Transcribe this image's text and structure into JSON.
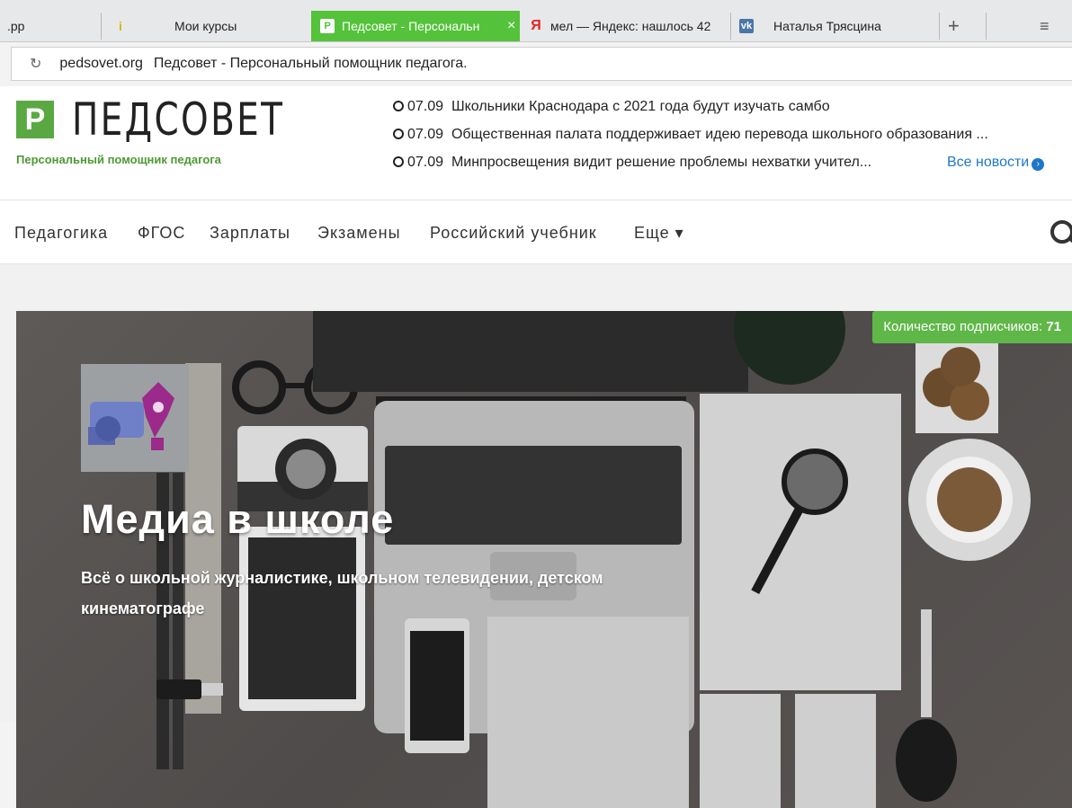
{
  "tabs": [
    {
      "label": ".pp"
    },
    {
      "label": "Мои курсы"
    },
    {
      "label": "Педсовет - Персональн",
      "icon": "pedsovet-icon",
      "active": true
    },
    {
      "label": "мел — Яндекс: нашлось 42",
      "icon": "yandex-icon"
    },
    {
      "label": "Наталья Трясцина",
      "icon": "vk-icon"
    }
  ],
  "tab_close": "×",
  "new_tab": "+",
  "menu": "≡",
  "address": {
    "domain": "pedsovet.org",
    "page_title": "Педсовет - Персональный помощник педагога."
  },
  "site": {
    "logo_mark": "P",
    "logo_text": "ПЕДСОВЕТ",
    "tagline": "Персональный помощник педагога",
    "news": [
      {
        "date": "07.09",
        "text": "Школьники Краснодара с 2021 года будут изучать самбо"
      },
      {
        "date": "07.09",
        "text": "Общественная палата поддерживает идею перевода школьного образования ..."
      },
      {
        "date": "07.09",
        "text": "Минпросвещения видит решение проблемы нехватки учител..."
      }
    ],
    "all_news": "Все новости",
    "nav": [
      "Педагогика",
      "ФГОС",
      "Зарплаты",
      "Экзамены",
      "Российский учебник",
      "Еще ▾"
    ]
  },
  "banner": {
    "subscribers_label": "Количество подписчиков:",
    "subscribers_value": "71",
    "title": "Медиа в школе",
    "subtitle": "Всё о школьной журналистике, школьном телевидении, детском кинематографе"
  },
  "colors": {
    "brand": "#5aa842",
    "active_tab": "#54c23a",
    "link": "#1e77c9"
  }
}
